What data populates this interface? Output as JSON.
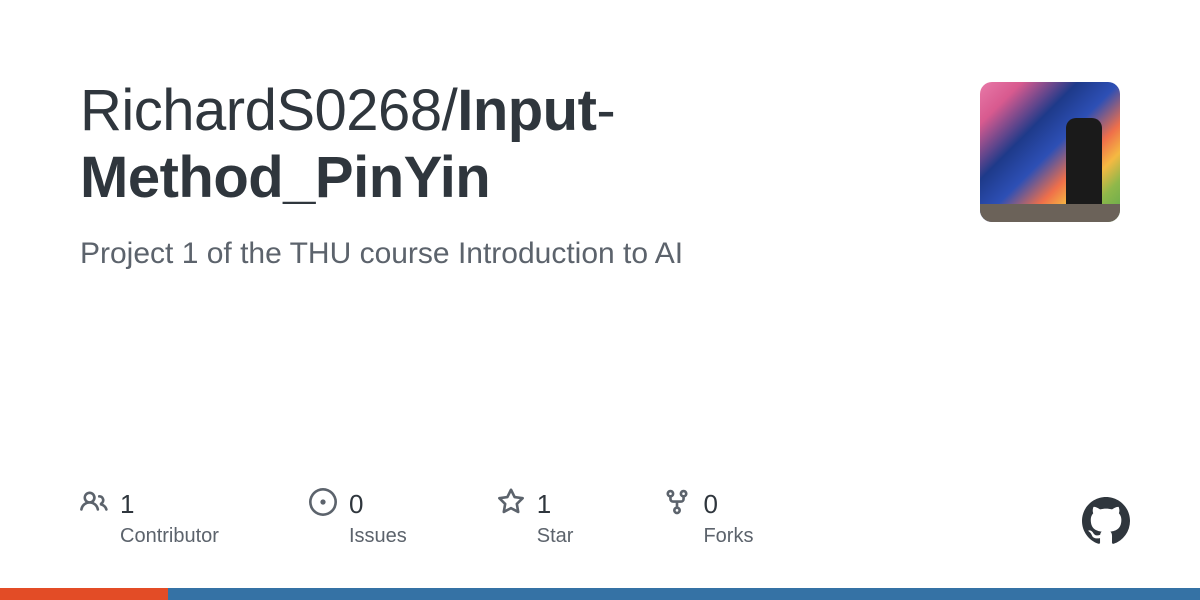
{
  "repo": {
    "owner": "RichardS0268",
    "name_part1": "Input",
    "name_part2": "Method_PinYin",
    "description": "Project 1 of the THU course Introduction to AI"
  },
  "stats": {
    "contributors": {
      "count": "1",
      "label": "Contributor"
    },
    "issues": {
      "count": "0",
      "label": "Issues"
    },
    "stars": {
      "count": "1",
      "label": "Star"
    },
    "forks": {
      "count": "0",
      "label": "Forks"
    }
  }
}
